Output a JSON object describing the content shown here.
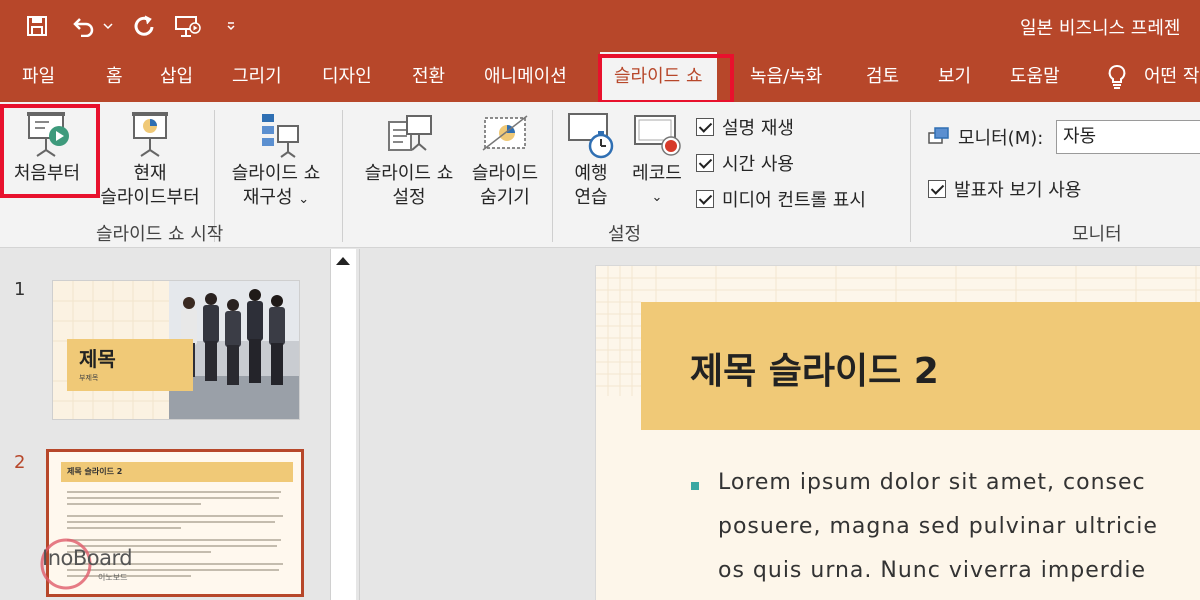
{
  "title_bar": {
    "document_title": "일본 비즈니스 프레젠",
    "quick_access": [
      "save-icon",
      "undo-icon",
      "undo-dropdown-icon",
      "redo-icon",
      "present-from-start-icon",
      "customize-qat-icon"
    ]
  },
  "menu_tabs": [
    {
      "label": "파일"
    },
    {
      "label": "홈"
    },
    {
      "label": "삽입"
    },
    {
      "label": "그리기"
    },
    {
      "label": "디자인"
    },
    {
      "label": "전환"
    },
    {
      "label": "애니메이션"
    },
    {
      "label": "슬라이드 쇼",
      "active": true
    },
    {
      "label": "녹음/녹화"
    },
    {
      "label": "검토"
    },
    {
      "label": "보기"
    },
    {
      "label": "도움말"
    },
    {
      "label": "어떤 작"
    }
  ],
  "ribbon": {
    "start_group": {
      "label": "슬라이드 쇼 시작",
      "from_beginning": "처음부터",
      "current_line1": "현재",
      "current_line2": "슬라이드부터",
      "custom_line1": "슬라이드 쇼",
      "custom_line2": "재구성"
    },
    "setup_group": {
      "label": "설정",
      "setup_line1": "슬라이드 쇼",
      "setup_line2": "설정",
      "hide_line1": "슬라이드",
      "hide_line2": "숨기기",
      "rehearse_line1": "예행",
      "rehearse_line2": "연습",
      "record_line1": "레코드",
      "checks": [
        {
          "label": "설명 재생",
          "checked": true
        },
        {
          "label": "시간 사용",
          "checked": true
        },
        {
          "label": "미디어 컨트롤 표시",
          "checked": true
        }
      ]
    },
    "monitor_group": {
      "label": "모니터",
      "monitor_label": "모니터(M):",
      "monitor_value": "자동",
      "presenter_view": "발표자 보기 사용",
      "presenter_checked": true
    }
  },
  "thumbnails": [
    {
      "number": "1",
      "title": "제목",
      "subtitle": "부제목"
    },
    {
      "number": "2",
      "title": "제목 슬라이드 2",
      "selected": true
    }
  ],
  "watermark": {
    "text": "InoBoard",
    "sub": "이노보드"
  },
  "slide": {
    "title": "제목 슬라이드 2",
    "lines": [
      "Lorem ipsum dolor sit amet, consec",
      "posuere, magna sed pulvinar ultricie",
      "os quis urna. Nunc viverra imperdie"
    ]
  },
  "colors": {
    "accent": "#b7472a",
    "highlight": "#e8112d",
    "title_band": "#f0c977",
    "bullet": "#3aa7a2"
  }
}
